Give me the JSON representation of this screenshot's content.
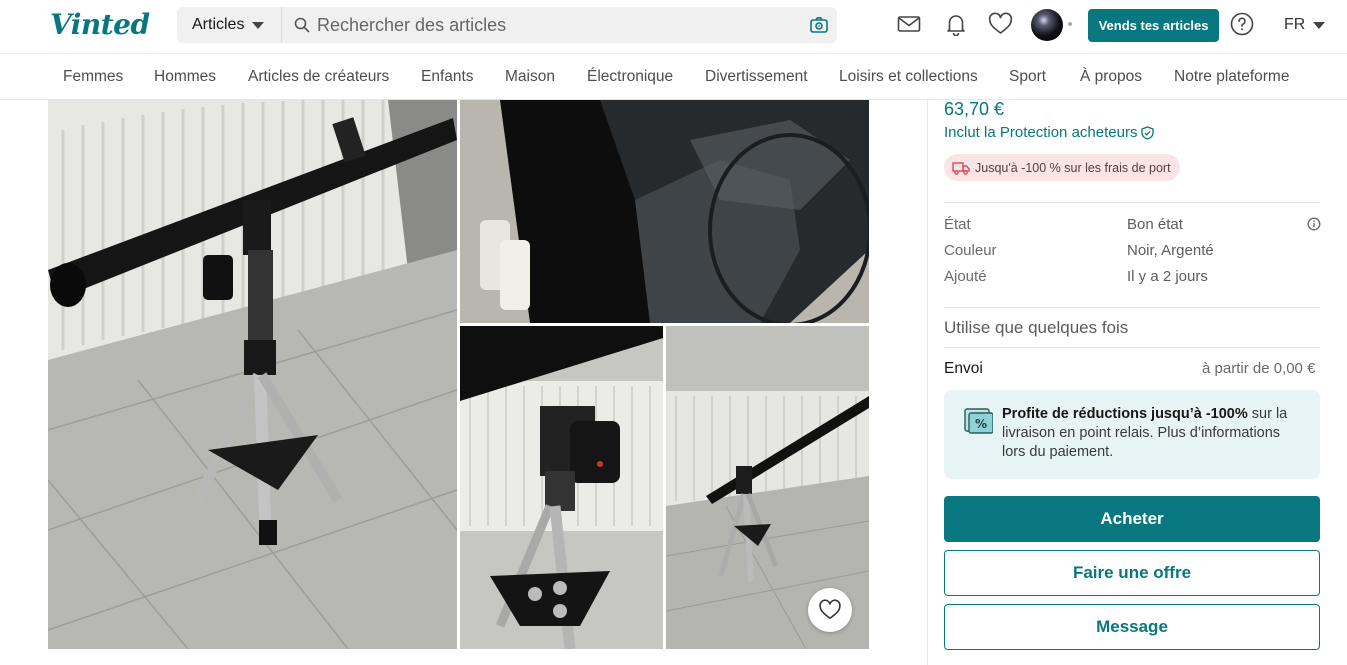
{
  "header": {
    "logo": "Vinted",
    "category_select": "Articles",
    "search_placeholder": "Rechercher des articles",
    "sell_button": "Vends tes articles",
    "language": "FR"
  },
  "nav": {
    "categories": [
      "Femmes",
      "Hommes",
      "Articles de créateurs",
      "Enfants",
      "Maison",
      "Électronique",
      "Divertissement",
      "Loisirs et collections",
      "Sport",
      "À propos",
      "Notre plateforme"
    ]
  },
  "item": {
    "price": "63,70 €",
    "protection": "Inclut la Protection acheteurs",
    "shipping_promo": "Jusqu'à -100 % sur les frais de port",
    "details": [
      {
        "label": "État",
        "value": "Bon état"
      },
      {
        "label": "Couleur",
        "value": "Noir, Argenté"
      },
      {
        "label": "Ajouté",
        "value": "Il y a 2 jours"
      }
    ],
    "description": "Utilise que quelques fois",
    "shipping_label": "Envoi",
    "shipping_value": "à partir de 0,00 €",
    "promo_bold": "Profite de réductions jusqu’à -100%",
    "promo_rest": " sur la livraison en point relais. Plus d’informations lors du paiement.",
    "buy_button": "Acheter",
    "offer_button": "Faire une offre",
    "message_button": "Message"
  },
  "colors": {
    "brand": "#09777f",
    "promo_bg": "#e6f4f5",
    "shipping_pill_bg": "#fbe4e6"
  },
  "icons": [
    "search-icon",
    "camera-icon",
    "mail-icon",
    "bell-icon",
    "heart-icon",
    "help-icon",
    "shield-check-icon",
    "truck-icon",
    "info-icon",
    "percent-icon"
  ]
}
